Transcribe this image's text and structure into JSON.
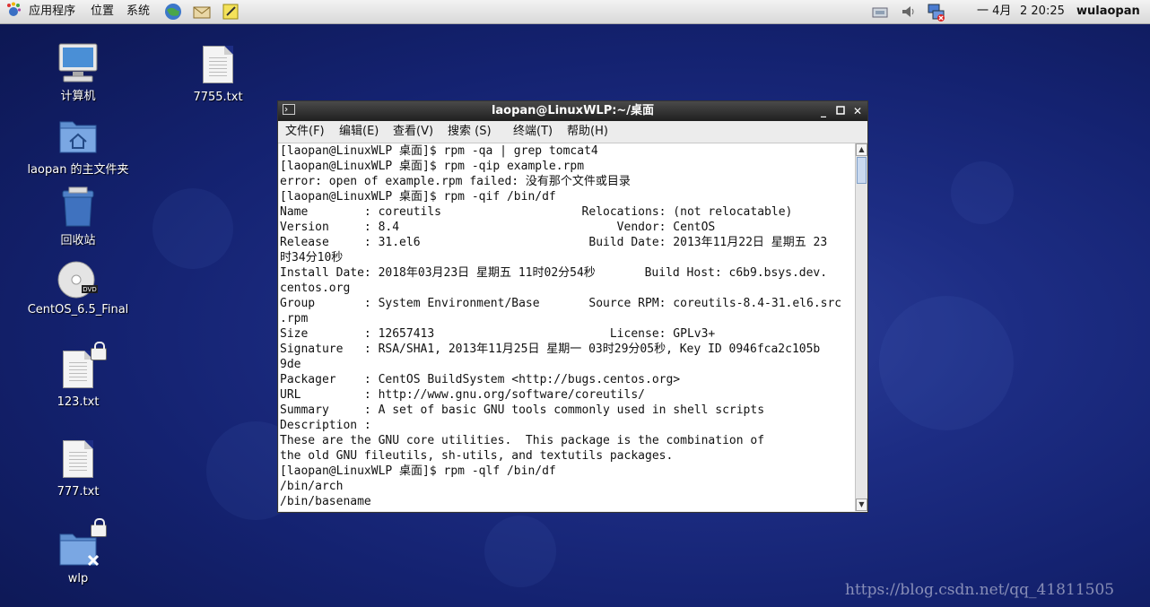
{
  "top_panel": {
    "applications": "应用程序",
    "places": "位置",
    "system": "系统",
    "date": "一 4月",
    "time": "2 20:25",
    "user": "wulaopan",
    "launchers": [
      "browser-icon",
      "mail-icon",
      "notes-icon"
    ],
    "tray": [
      "network-manager-icon",
      "volume-icon",
      "network-offline-icon"
    ]
  },
  "desktop": {
    "icons": [
      {
        "label": "计算机",
        "icon": "computer-icon"
      },
      {
        "label": "7755.txt",
        "icon": "text-file-icon"
      },
      {
        "label": "laopan 的主文件夹",
        "icon": "home-folder-icon"
      },
      {
        "label": "回收站",
        "icon": "trash-icon"
      },
      {
        "label": "CentOS_6.5_Final",
        "icon": "dvd-icon"
      },
      {
        "label": "123.txt",
        "icon": "text-file-icon"
      },
      {
        "label": "777.txt",
        "icon": "text-file-icon"
      },
      {
        "label": "wlp",
        "icon": "folder-icon"
      }
    ]
  },
  "terminal": {
    "title": "laopan@LinuxWLP:~/桌面",
    "menu": [
      "文件(F)",
      "编辑(E)",
      "查看(V)",
      "搜索 (S)",
      "终端(T)",
      "帮助(H)"
    ],
    "lines": [
      "[laopan@LinuxWLP 桌面]$ rpm -qa | grep tomcat4",
      "[laopan@LinuxWLP 桌面]$ rpm -qip example.rpm",
      "error: open of example.rpm failed: 没有那个文件或目录",
      "[laopan@LinuxWLP 桌面]$ rpm -qif /bin/df",
      "Name        : coreutils                    Relocations: (not relocatable)",
      "Version     : 8.4                               Vendor: CentOS",
      "Release     : 31.el6                        Build Date: 2013年11月22日 星期五 23",
      "时34分10秒",
      "Install Date: 2018年03月23日 星期五 11时02分54秒       Build Host: c6b9.bsys.dev.",
      "centos.org",
      "Group       : System Environment/Base       Source RPM: coreutils-8.4-31.el6.src",
      ".rpm",
      "Size        : 12657413                         License: GPLv3+",
      "Signature   : RSA/SHA1, 2013年11月25日 星期一 03时29分05秒, Key ID 0946fca2c105b",
      "9de",
      "Packager    : CentOS BuildSystem <http://bugs.centos.org>",
      "URL         : http://www.gnu.org/software/coreutils/",
      "Summary     : A set of basic GNU tools commonly used in shell scripts",
      "Description :",
      "These are the GNU core utilities.  This package is the combination of",
      "the old GNU fileutils, sh-utils, and textutils packages.",
      "[laopan@LinuxWLP 桌面]$ rpm -qlf /bin/df",
      "/bin/arch",
      "/bin/basename"
    ]
  },
  "watermark": "https://blog.csdn.net/qq_41811505"
}
